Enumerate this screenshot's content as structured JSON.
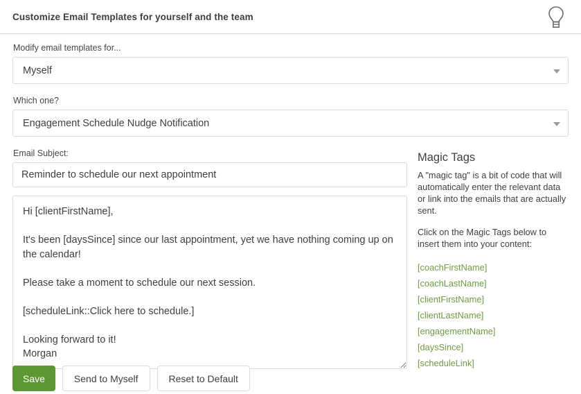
{
  "header": {
    "title": "Customize Email Templates for yourself and the team",
    "icon": "lightbulb-icon"
  },
  "form": {
    "audience": {
      "label": "Modify email templates for...",
      "value": "Myself",
      "caret_icon": "chevron-down-icon"
    },
    "template": {
      "label": "Which one?",
      "value": "Engagement Schedule Nudge Notification",
      "caret_icon": "chevron-down-icon"
    },
    "subject": {
      "label": "Email Subject:",
      "value": "Reminder to schedule our next appointment",
      "placeholder": ""
    },
    "body": {
      "value": "Hi [clientFirstName],\n\nIt's been [daysSince] since our last appointment, yet we have nothing coming up on the calendar!\n\nPlease take a moment to schedule our next session.\n\n[scheduleLink::Click here to schedule.]\n\nLooking forward to it!\nMorgan",
      "placeholder": ""
    }
  },
  "magic_tags": {
    "title": "Magic Tags",
    "description": "A \"magic tag\" is a bit of code that will automatically enter the relevant data or link into the emails that are actually sent.",
    "instruction": "Click on the Magic Tags below to insert them into your content:",
    "link_color": "#6f9c3f",
    "tags": [
      "[coachFirstName]",
      "[coachLastName]",
      "[clientFirstName]",
      "[clientLastName]",
      "[engagementName]",
      "[daysSince]",
      "[scheduleLink]"
    ]
  },
  "actions": {
    "save": "Save",
    "send_to_myself": "Send to Myself",
    "reset_to_default": "Reset to Default",
    "primary_color": "#5d9732"
  }
}
